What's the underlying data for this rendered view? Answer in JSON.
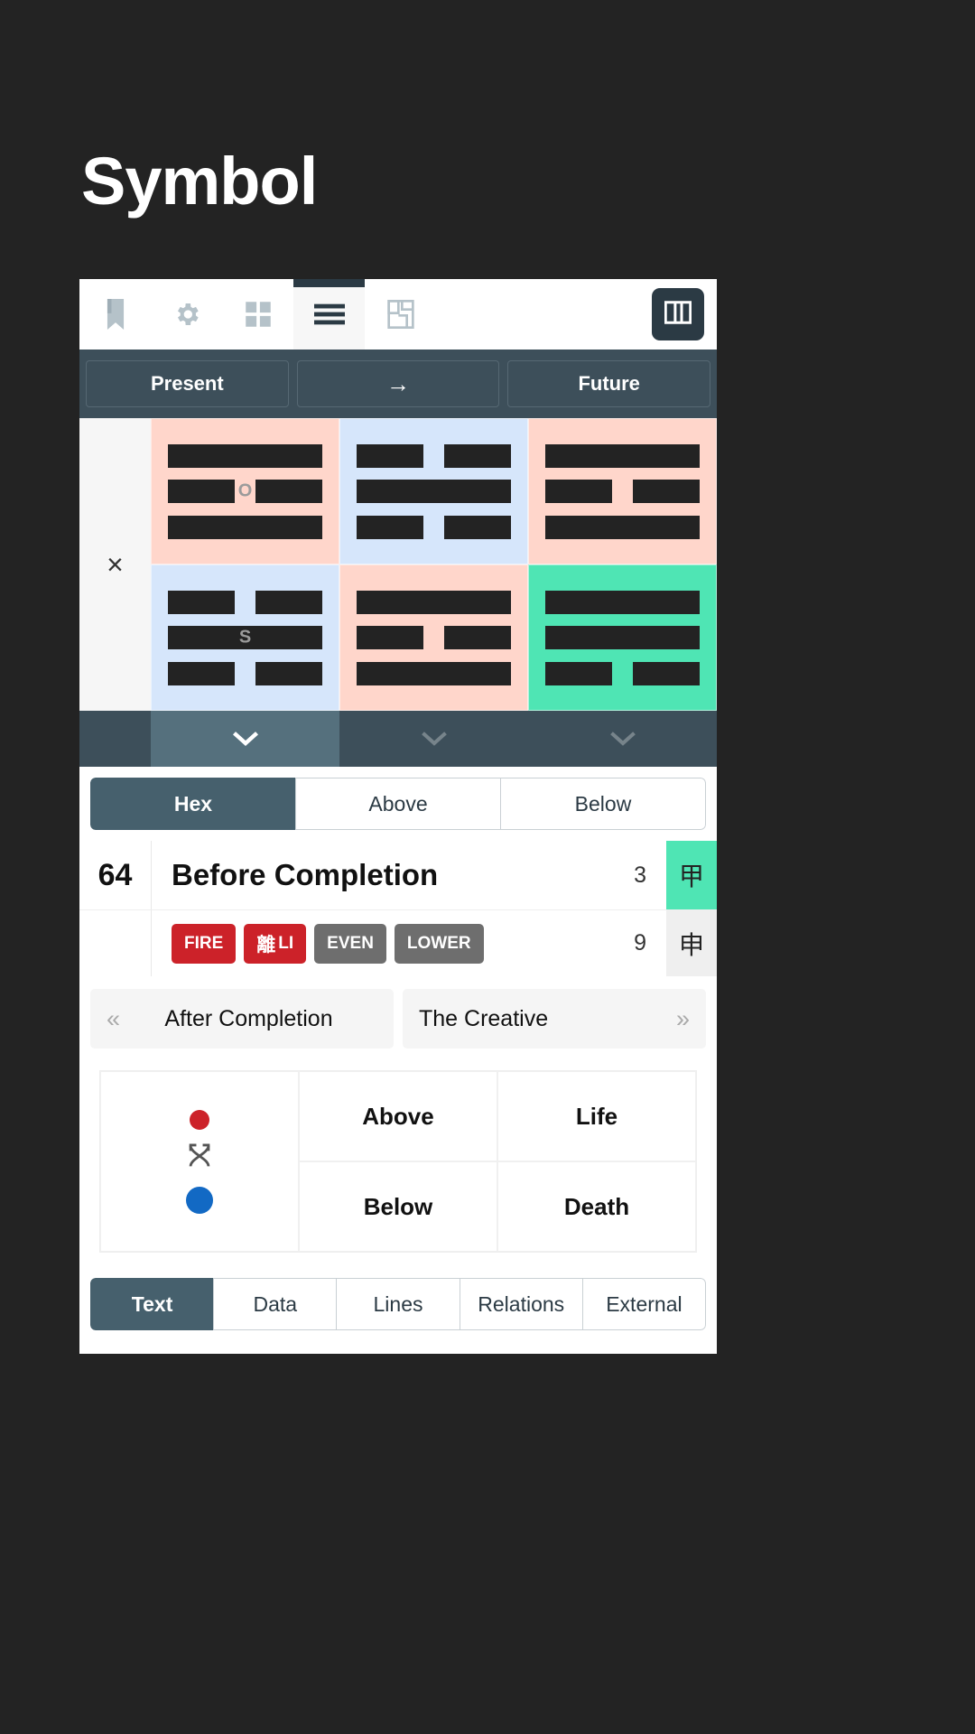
{
  "page": {
    "title": "Symbol",
    "background": "#232323"
  },
  "toolbar": {
    "items": [
      {
        "icon": "bookmark-icon",
        "active": false
      },
      {
        "icon": "gear-icon",
        "active": false
      },
      {
        "icon": "grid-icon",
        "active": false
      },
      {
        "icon": "hamburger-menu-icon",
        "active": true
      },
      {
        "icon": "layout-plan-icon",
        "active": false
      }
    ],
    "columns_button_icon": "columns-icon"
  },
  "timebar": {
    "present_label": "Present",
    "arrow_label": "→",
    "future_label": "Future"
  },
  "trigram_grid": {
    "close_label": "×",
    "cells": [
      {
        "bg": "#ffd6cb",
        "badge": "O",
        "lines": [
          "yang",
          "yin",
          "yang"
        ]
      },
      {
        "bg": "#d6e6fb",
        "badge": "",
        "lines": [
          "yin",
          "yang",
          "yin"
        ]
      },
      {
        "bg": "#ffd6cb",
        "badge": "",
        "lines": [
          "yang",
          "yin",
          "yang"
        ]
      },
      {
        "bg": "#d6e6fb",
        "badge": "S",
        "lines": [
          "yin",
          "yang",
          "yin"
        ]
      },
      {
        "bg": "#ffd6cb",
        "badge": "",
        "lines": [
          "yang",
          "yin",
          "yang"
        ]
      },
      {
        "bg": "#4fe5b4",
        "badge": "",
        "lines": [
          "yang",
          "yang",
          "yin"
        ]
      }
    ]
  },
  "chevron_bar": {
    "buttons": [
      {
        "icon": "chevron-down-icon",
        "active": true
      },
      {
        "icon": "chevron-down-icon",
        "active": false
      },
      {
        "icon": "chevron-down-icon",
        "active": false
      }
    ],
    "glyph": "⌄"
  },
  "hex_tabs": {
    "items": [
      {
        "label": "Hex",
        "active": true
      },
      {
        "label": "Above",
        "active": false
      },
      {
        "label": "Below",
        "active": false
      }
    ]
  },
  "hexagram": {
    "number": "64",
    "name": "Before Completion",
    "primary_count": "3",
    "primary_glyph": "甲",
    "secondary_count": "9",
    "secondary_glyph": "申",
    "badges": [
      {
        "label": "FIRE",
        "cjk": "",
        "color": "red"
      },
      {
        "label": "LI",
        "cjk": "離",
        "color": "red"
      },
      {
        "label": "EVEN",
        "cjk": "",
        "color": "grey"
      },
      {
        "label": "LOWER",
        "cjk": "",
        "color": "grey"
      }
    ]
  },
  "prev_next": {
    "prev_chevron": "«",
    "prev_label": "After Completion",
    "next_label": "The Creative",
    "next_chevron": "»"
  },
  "polarity": {
    "above_label": "Above",
    "below_label": "Below",
    "life_label": "Life",
    "death_label": "Death",
    "top_dot_color": "#cc2229",
    "bottom_dot_color": "#1269c4",
    "swap_icon": "swap-arrows-icon"
  },
  "bottom_tabs": {
    "items": [
      {
        "label": "Text",
        "active": true
      },
      {
        "label": "Data",
        "active": false
      },
      {
        "label": "Lines",
        "active": false
      },
      {
        "label": "Relations",
        "active": false
      },
      {
        "label": "External",
        "active": false
      }
    ]
  }
}
